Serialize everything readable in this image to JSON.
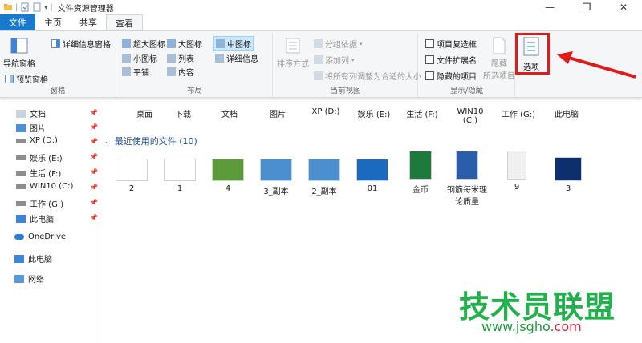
{
  "window": {
    "title": "文件资源管理器"
  },
  "window_controls": {
    "minimize": "—",
    "maximize": "❐",
    "close": "✕"
  },
  "tabs": [
    "文件",
    "主页",
    "共享",
    "查看"
  ],
  "ribbon": {
    "pane_group": {
      "nav_pane": "导航窗格",
      "preview_pane": "预览窗格",
      "details_pane": "详细信息窗格",
      "label": "窗格"
    },
    "layout_group": {
      "items": [
        "超大图标",
        "大图标",
        "中图标",
        "小图标",
        "列表",
        "详细信息",
        "平铺",
        "内容"
      ],
      "selected": "中图标",
      "label": "布局"
    },
    "view_group": {
      "sort": "排序方式",
      "group_by": "分组依据",
      "add_column": "添加列",
      "fit_columns": "将所有列调整为合适的大小",
      "label": "当前视图"
    },
    "showhide_group": {
      "item_checkboxes": "项目复选框",
      "file_extensions": "文件扩展名",
      "hidden_items": "隐藏的项目",
      "hide": "隐藏",
      "hide_selected": "所选项目",
      "label": "显示/隐藏"
    },
    "options": {
      "label": "选项"
    }
  },
  "sidebar": {
    "quick_items": [
      {
        "label": "文档",
        "icon": "document-icon"
      },
      {
        "label": "图片",
        "icon": "picture-icon"
      },
      {
        "label": "XP (D:)",
        "icon": "drive-icon"
      },
      {
        "label": "娱乐 (E:)",
        "icon": "drive-icon"
      },
      {
        "label": "生活 (F:)",
        "icon": "drive-icon"
      },
      {
        "label": "WIN10 (C:)",
        "icon": "drive-icon"
      },
      {
        "label": "工作 (G:)",
        "icon": "drive-icon"
      },
      {
        "label": "此电脑",
        "icon": "computer-icon"
      }
    ],
    "onedrive": "OneDrive",
    "this_pc": "此电脑",
    "network": "网络"
  },
  "frequent": [
    "桌面",
    "下载",
    "文档",
    "图片",
    "XP (D:)",
    "娱乐 (E:)",
    "生活 (F:)",
    "WIN10\n(C:)",
    "工作 (G:)",
    "此电脑"
  ],
  "recent": {
    "header": "最近使用的文件 (10)",
    "files": [
      "2",
      "1",
      "4",
      "3_副本",
      "2_副本",
      "01",
      "金币",
      "钢筋每米理论质量",
      "9",
      "3"
    ]
  },
  "watermark": {
    "cn": "技术员联盟",
    "url_a": "www.jsgho.",
    "url_b": "com"
  },
  "colors": {
    "accent": "#1979ca",
    "highlight": "#e11b1b",
    "selected_bg": "#cce8ff",
    "watermark": "#22b14c"
  }
}
